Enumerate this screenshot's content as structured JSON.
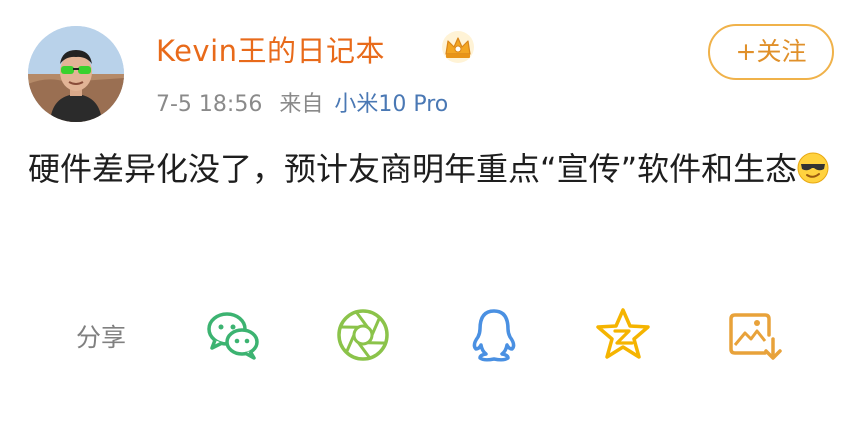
{
  "post": {
    "username": "Kevin王的日记本",
    "timestamp": "7-5 18:56",
    "from_label": "来自",
    "source": "小米10 Pro",
    "follow_label": "+关注",
    "text": "硬件差异化没了，预计友商明年重点“宣传”软件和生态"
  },
  "share": {
    "label": "分享",
    "icons": [
      "wechat-icon",
      "moments-icon",
      "qq-icon",
      "qzone-icon",
      "save-image-icon"
    ]
  },
  "colors": {
    "username": "#e86a1a",
    "source": "#4a78b4",
    "follow_border": "#f0b24a",
    "wechat": "#3cb371",
    "moments": "#8bc34a",
    "qq": "#4a90e2",
    "qzone": "#f5b400",
    "save": "#e8a23a"
  }
}
